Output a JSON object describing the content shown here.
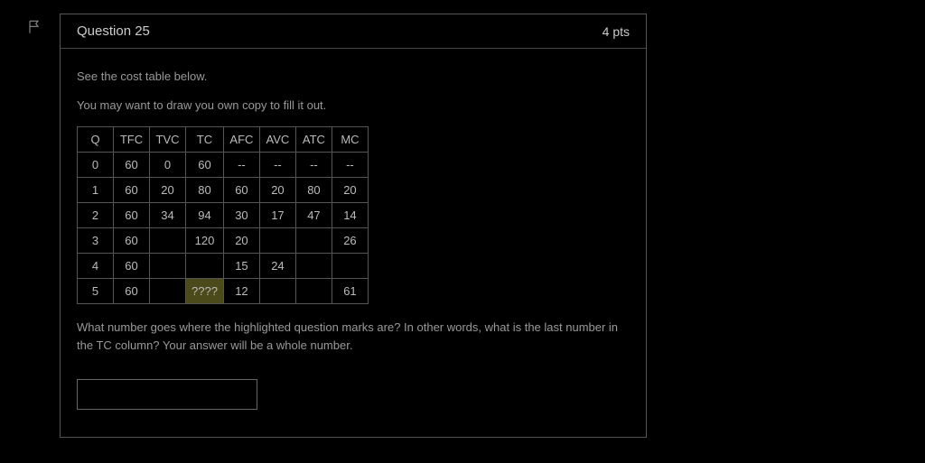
{
  "header": {
    "title": "Question 25",
    "points": "4 pts"
  },
  "body": {
    "instruction1": "See the cost table below.",
    "instruction2": "You may want to draw you own copy to fill it out.",
    "prompt": "What number goes where the highlighted question marks are?  In other words, what is the last number in the TC column?  Your answer will be a whole number."
  },
  "table": {
    "headers": [
      "Q",
      "TFC",
      "TVC",
      "TC",
      "AFC",
      "AVC",
      "ATC",
      "MC"
    ],
    "rows": [
      [
        "0",
        "60",
        "0",
        "60",
        "--",
        "--",
        "--",
        "--"
      ],
      [
        "1",
        "60",
        "20",
        "80",
        "60",
        "20",
        "80",
        "20"
      ],
      [
        "2",
        "60",
        "34",
        "94",
        "30",
        "17",
        "47",
        "14"
      ],
      [
        "3",
        "60",
        "",
        "120",
        "20",
        "",
        "",
        "26"
      ],
      [
        "4",
        "60",
        "",
        "",
        "15",
        "24",
        "",
        ""
      ],
      [
        "5",
        "60",
        "",
        "????",
        "12",
        "",
        "",
        "61"
      ]
    ],
    "highlight": {
      "row": 5,
      "col": 3
    }
  },
  "answer": {
    "value": ""
  }
}
